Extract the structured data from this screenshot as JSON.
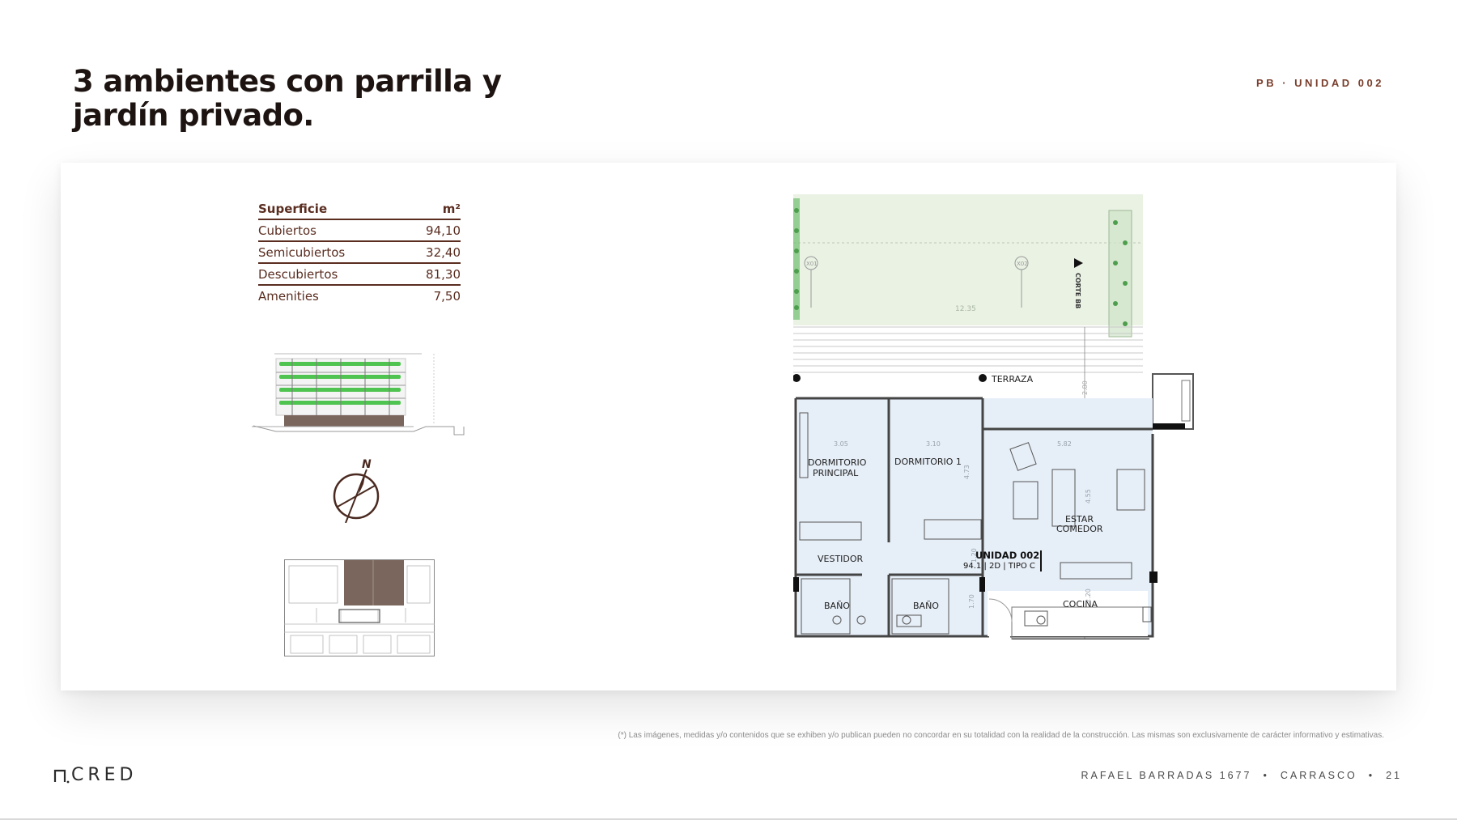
{
  "header": {
    "title": "3 ambientes con parrilla y jardín privado.",
    "unit_tag": "PB · UNIDAD 002"
  },
  "area_table": {
    "header_label": "Superficie",
    "header_unit": "m²",
    "rows": [
      {
        "label": "Cubiertos",
        "value": "94,10"
      },
      {
        "label": "Semicubiertos",
        "value": "32,40"
      },
      {
        "label": "Descubiertos",
        "value": "81,30"
      },
      {
        "label": "Amenities",
        "value": "7,50"
      }
    ]
  },
  "compass": {
    "north_label": "N"
  },
  "floorplan": {
    "rooms": {
      "terraza": "TERRAZA",
      "dormitorio_principal_1": "DORMITORIO",
      "dormitorio_principal_2": "PRINCIPAL",
      "dormitorio_1": "DORMITORIO 1",
      "estar_1": "ESTAR",
      "estar_2": "COMEDOR",
      "vestidor": "VESTIDOR",
      "bano_1": "BAÑO",
      "bano_2": "BAÑO",
      "cocina": "COCINA"
    },
    "unit_label": "UNIDAD 002",
    "unit_sub": "94.1 | 2D | TIPO C",
    "section_label": "CORTE BB",
    "axis_labels": [
      "X01",
      "X02"
    ],
    "dimensions": {
      "garden_width": "12.35",
      "terrace_depth": "2.80",
      "dorm_principal_width": "3.05",
      "dorm_1_width": "3.10",
      "estar_width": "5.82",
      "dorm_1_depth": "4.73",
      "estar_depth": "4.55",
      "hall": "1.70",
      "bano_2_width": "1.20",
      "cocina_depth": "2.20"
    }
  },
  "disclaimer": "(*) Las imágenes, medidas y/o contenidos que se exhiben y/o publican pueden no concordar en su totalidad con la realidad de la construcción. Las mismas son exclusivamente de carácter informativo y estimativas.",
  "footer": {
    "brand": "CRED",
    "address": "RAFAEL BARRADAS 1677",
    "neighborhood": "CARRASCO",
    "page_number": "21"
  },
  "colors": {
    "title": "#1d1411",
    "accent": "#7a3e2c",
    "table_text": "#5a2d20",
    "garden_fill": "#eaf2e4",
    "interior_fill": "#e6eef7",
    "building_brown": "#7a665d"
  }
}
